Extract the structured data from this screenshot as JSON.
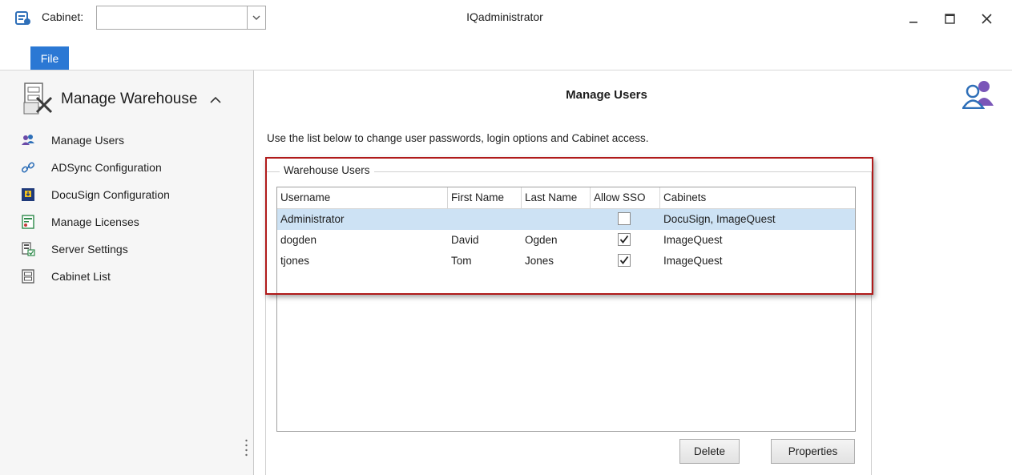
{
  "titlebar": {
    "cabinet_label": "Cabinet:",
    "cabinet_value": "",
    "window_title": "IQadministrator",
    "minimize_glyph": "–",
    "maximize_glyph": "☐",
    "close_glyph": "✕"
  },
  "ribbon": {
    "file_tab": "File",
    "accent": "#2b78d4"
  },
  "sidebar": {
    "header": "Manage Warehouse",
    "items": [
      {
        "label": "Manage Users",
        "icon": "users-icon"
      },
      {
        "label": "ADSync Configuration",
        "icon": "link-icon"
      },
      {
        "label": "DocuSign Configuration",
        "icon": "docusign-icon"
      },
      {
        "label": "Manage Licenses",
        "icon": "license-icon"
      },
      {
        "label": "Server Settings",
        "icon": "server-settings-icon"
      },
      {
        "label": "Cabinet List",
        "icon": "cabinet-list-icon"
      }
    ]
  },
  "main": {
    "title": "Manage Users",
    "description": "Use the list below to change user passwords, login options and Cabinet access.",
    "group_label": "Warehouse Users",
    "columns": [
      "Username",
      "First Name",
      "Last Name",
      "Allow SSO",
      "Cabinets"
    ],
    "rows": [
      {
        "username": "Administrator",
        "first": "",
        "last": "",
        "sso": false,
        "cabinets": "DocuSign, ImageQuest",
        "selected": true
      },
      {
        "username": "dogden",
        "first": "David",
        "last": "Ogden",
        "sso": true,
        "cabinets": "ImageQuest",
        "selected": false
      },
      {
        "username": "tjones",
        "first": "Tom",
        "last": "Jones",
        "sso": true,
        "cabinets": "ImageQuest",
        "selected": false
      }
    ],
    "delete_label": "Delete",
    "properties_label": "Properties"
  },
  "colors": {
    "selected_row": "#cde2f4",
    "highlight_border": "#b01a1a"
  }
}
